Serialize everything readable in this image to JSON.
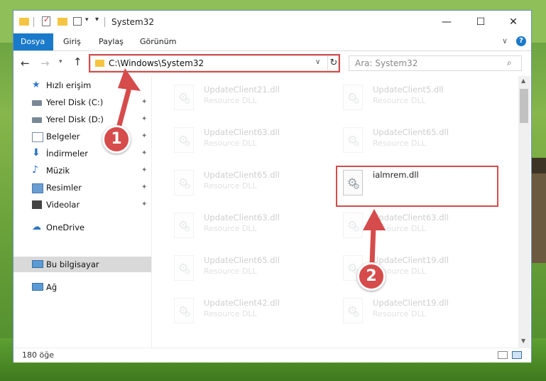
{
  "window": {
    "title": "System32"
  },
  "ribbon": {
    "tabs": [
      "Dosya",
      "Giriş",
      "Paylaş",
      "Görünüm"
    ]
  },
  "address": {
    "path": "C:\\Windows\\System32"
  },
  "search": {
    "placeholder": "Ara: System32"
  },
  "sidebar": {
    "items": [
      {
        "label": "Hızlı erişim",
        "icon": "star-icon"
      },
      {
        "label": "Yerel Disk (C:)",
        "icon": "drive-icon",
        "pinned": true
      },
      {
        "label": "Yerel Disk (D:)",
        "icon": "drive-icon",
        "pinned": true
      },
      {
        "label": "Belgeler",
        "icon": "documents-icon",
        "pinned": true
      },
      {
        "label": "İndirmeler",
        "icon": "download-icon",
        "pinned": true
      },
      {
        "label": "Müzik",
        "icon": "music-icon",
        "pinned": true
      },
      {
        "label": "Resimler",
        "icon": "pictures-icon",
        "pinned": true
      },
      {
        "label": "Videolar",
        "icon": "videos-icon",
        "pinned": true
      },
      {
        "label": "OneDrive",
        "icon": "cloud-icon"
      },
      {
        "label": "Bu bilgisayar",
        "icon": "computer-icon",
        "selected": true
      },
      {
        "label": "Ağ",
        "icon": "network-icon"
      }
    ]
  },
  "files": [
    {
      "name": "UpdateClient21.dll",
      "type": "Resource DLL"
    },
    {
      "name": "UpdateClient5.dll",
      "type": "Resource DLL"
    },
    {
      "name": "UpdateClient63.dll",
      "type": "Resource DLL"
    },
    {
      "name": "UpdateClient65.dll",
      "type": "Resource DLL"
    },
    {
      "name": "UpdateClient65.dll",
      "type": "Resource DLL"
    },
    {
      "name": "ialmrem.dll",
      "type": ""
    },
    {
      "name": "UpdateClient63.dll",
      "type": "Resource DLL"
    },
    {
      "name": "UpdateClient63.dll",
      "type": "Resource DLL"
    },
    {
      "name": "UpdateClient65.dll",
      "type": "Resource DLL"
    },
    {
      "name": "UpdateClient19.dll",
      "type": "Resource DLL"
    },
    {
      "name": "UpdateClient42.dll",
      "type": "Resource DLL"
    },
    {
      "name": "UpdateClient19.dll",
      "type": "Resource DLL"
    }
  ],
  "status": {
    "item_count": "180 öğe"
  },
  "annotations": {
    "step1": "1",
    "step2": "2"
  },
  "colors": {
    "accent": "#1979ca",
    "highlight": "#d64b4b"
  }
}
